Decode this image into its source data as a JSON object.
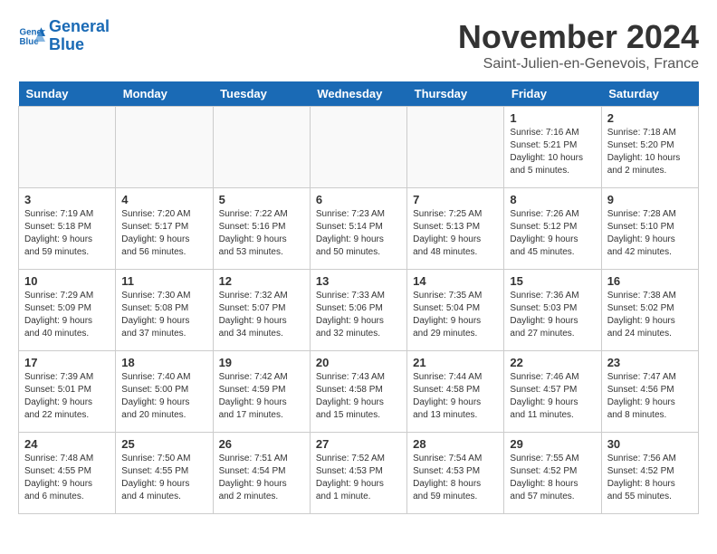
{
  "header": {
    "logo_line1": "General",
    "logo_line2": "Blue",
    "month_title": "November 2024",
    "location": "Saint-Julien-en-Genevois, France"
  },
  "weekdays": [
    "Sunday",
    "Monday",
    "Tuesday",
    "Wednesday",
    "Thursday",
    "Friday",
    "Saturday"
  ],
  "weeks": [
    [
      {
        "day": "",
        "info": ""
      },
      {
        "day": "",
        "info": ""
      },
      {
        "day": "",
        "info": ""
      },
      {
        "day": "",
        "info": ""
      },
      {
        "day": "",
        "info": ""
      },
      {
        "day": "1",
        "info": "Sunrise: 7:16 AM\nSunset: 5:21 PM\nDaylight: 10 hours\nand 5 minutes."
      },
      {
        "day": "2",
        "info": "Sunrise: 7:18 AM\nSunset: 5:20 PM\nDaylight: 10 hours\nand 2 minutes."
      }
    ],
    [
      {
        "day": "3",
        "info": "Sunrise: 7:19 AM\nSunset: 5:18 PM\nDaylight: 9 hours\nand 59 minutes."
      },
      {
        "day": "4",
        "info": "Sunrise: 7:20 AM\nSunset: 5:17 PM\nDaylight: 9 hours\nand 56 minutes."
      },
      {
        "day": "5",
        "info": "Sunrise: 7:22 AM\nSunset: 5:16 PM\nDaylight: 9 hours\nand 53 minutes."
      },
      {
        "day": "6",
        "info": "Sunrise: 7:23 AM\nSunset: 5:14 PM\nDaylight: 9 hours\nand 50 minutes."
      },
      {
        "day": "7",
        "info": "Sunrise: 7:25 AM\nSunset: 5:13 PM\nDaylight: 9 hours\nand 48 minutes."
      },
      {
        "day": "8",
        "info": "Sunrise: 7:26 AM\nSunset: 5:12 PM\nDaylight: 9 hours\nand 45 minutes."
      },
      {
        "day": "9",
        "info": "Sunrise: 7:28 AM\nSunset: 5:10 PM\nDaylight: 9 hours\nand 42 minutes."
      }
    ],
    [
      {
        "day": "10",
        "info": "Sunrise: 7:29 AM\nSunset: 5:09 PM\nDaylight: 9 hours\nand 40 minutes."
      },
      {
        "day": "11",
        "info": "Sunrise: 7:30 AM\nSunset: 5:08 PM\nDaylight: 9 hours\nand 37 minutes."
      },
      {
        "day": "12",
        "info": "Sunrise: 7:32 AM\nSunset: 5:07 PM\nDaylight: 9 hours\nand 34 minutes."
      },
      {
        "day": "13",
        "info": "Sunrise: 7:33 AM\nSunset: 5:06 PM\nDaylight: 9 hours\nand 32 minutes."
      },
      {
        "day": "14",
        "info": "Sunrise: 7:35 AM\nSunset: 5:04 PM\nDaylight: 9 hours\nand 29 minutes."
      },
      {
        "day": "15",
        "info": "Sunrise: 7:36 AM\nSunset: 5:03 PM\nDaylight: 9 hours\nand 27 minutes."
      },
      {
        "day": "16",
        "info": "Sunrise: 7:38 AM\nSunset: 5:02 PM\nDaylight: 9 hours\nand 24 minutes."
      }
    ],
    [
      {
        "day": "17",
        "info": "Sunrise: 7:39 AM\nSunset: 5:01 PM\nDaylight: 9 hours\nand 22 minutes."
      },
      {
        "day": "18",
        "info": "Sunrise: 7:40 AM\nSunset: 5:00 PM\nDaylight: 9 hours\nand 20 minutes."
      },
      {
        "day": "19",
        "info": "Sunrise: 7:42 AM\nSunset: 4:59 PM\nDaylight: 9 hours\nand 17 minutes."
      },
      {
        "day": "20",
        "info": "Sunrise: 7:43 AM\nSunset: 4:58 PM\nDaylight: 9 hours\nand 15 minutes."
      },
      {
        "day": "21",
        "info": "Sunrise: 7:44 AM\nSunset: 4:58 PM\nDaylight: 9 hours\nand 13 minutes."
      },
      {
        "day": "22",
        "info": "Sunrise: 7:46 AM\nSunset: 4:57 PM\nDaylight: 9 hours\nand 11 minutes."
      },
      {
        "day": "23",
        "info": "Sunrise: 7:47 AM\nSunset: 4:56 PM\nDaylight: 9 hours\nand 8 minutes."
      }
    ],
    [
      {
        "day": "24",
        "info": "Sunrise: 7:48 AM\nSunset: 4:55 PM\nDaylight: 9 hours\nand 6 minutes."
      },
      {
        "day": "25",
        "info": "Sunrise: 7:50 AM\nSunset: 4:55 PM\nDaylight: 9 hours\nand 4 minutes."
      },
      {
        "day": "26",
        "info": "Sunrise: 7:51 AM\nSunset: 4:54 PM\nDaylight: 9 hours\nand 2 minutes."
      },
      {
        "day": "27",
        "info": "Sunrise: 7:52 AM\nSunset: 4:53 PM\nDaylight: 9 hours\nand 1 minute."
      },
      {
        "day": "28",
        "info": "Sunrise: 7:54 AM\nSunset: 4:53 PM\nDaylight: 8 hours\nand 59 minutes."
      },
      {
        "day": "29",
        "info": "Sunrise: 7:55 AM\nSunset: 4:52 PM\nDaylight: 8 hours\nand 57 minutes."
      },
      {
        "day": "30",
        "info": "Sunrise: 7:56 AM\nSunset: 4:52 PM\nDaylight: 8 hours\nand 55 minutes."
      }
    ]
  ]
}
